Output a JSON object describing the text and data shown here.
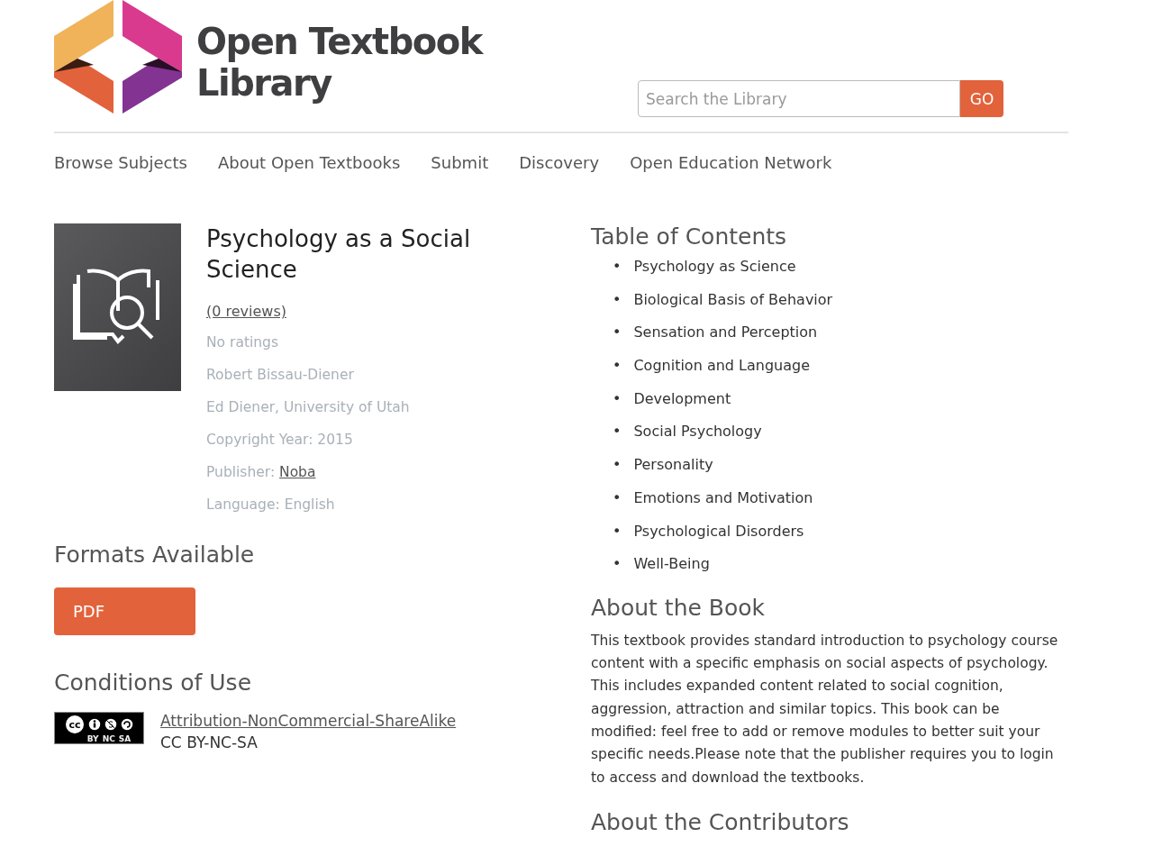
{
  "logo": {
    "line1": "Open Textbook",
    "line2": "Library"
  },
  "search": {
    "placeholder": "Search the Library",
    "button": "GO"
  },
  "nav": [
    "Browse Subjects",
    "About Open Textbooks",
    "Submit",
    "Discovery",
    "Open Education Network"
  ],
  "book": {
    "title": "Psychology as a Social Science",
    "reviews": "(0 reviews)",
    "rating": "No ratings",
    "details": [
      {
        "kind": "text",
        "text": "Robert Bissau-Diener"
      },
      {
        "kind": "text",
        "text": "Ed Diener, University of Utah"
      },
      {
        "kind": "text",
        "text": "Copyright Year: 2015"
      },
      {
        "kind": "link",
        "label": "Publisher: ",
        "text": "Noba"
      },
      {
        "kind": "text",
        "text": "Language: English"
      }
    ]
  },
  "formats": {
    "heading": "Formats Available",
    "buttons": [
      "PDF"
    ]
  },
  "conditions": {
    "heading": "Conditions of Use",
    "badge": {
      "cc": "cc",
      "labels": [
        "BY",
        "NC",
        "SA"
      ]
    },
    "license_link": "Attribution-NonCommercial-ShareAlike",
    "license_code": "CC BY-NC-SA"
  },
  "toc": {
    "heading": "Table of Contents",
    "bullet": "•",
    "items": [
      "Psychology as Science",
      "Biological Basis of Behavior",
      "Sensation and Perception",
      "Cognition and Language",
      "Development",
      "Social Psychology",
      "Personality",
      "Emotions and Motivation",
      "Psychological Disorders",
      "Well-Being"
    ]
  },
  "about": {
    "heading": "About the Book",
    "text": "This textbook provides standard introduction to psychology course content with a specific emphasis on social aspects of psychology. This includes expanded content related to social cognition, aggression, attraction and similar topics. This book can be modified: feel free to add or remove modules to better suit your specific needs.Please note that the publisher requires you to login to access and download the textbooks."
  },
  "contributors": {
    "heading": "About the Contributors"
  }
}
